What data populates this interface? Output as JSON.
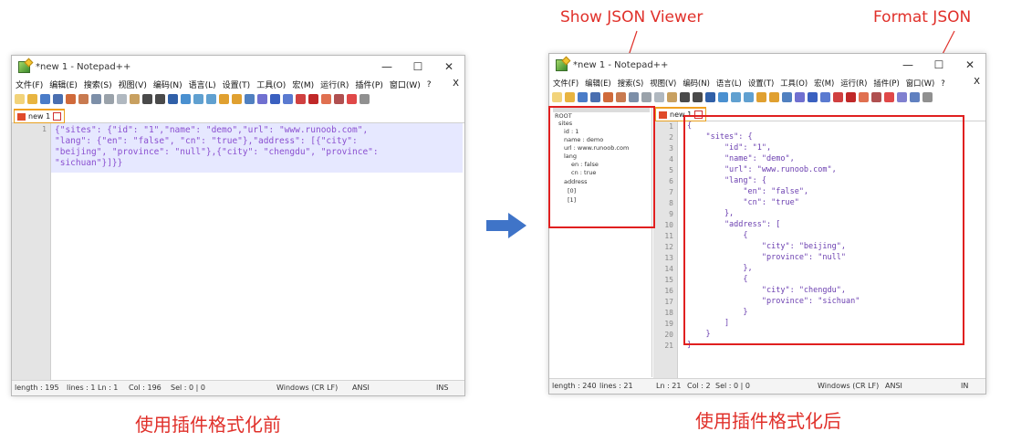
{
  "annotations": {
    "show_json_viewer": "Show JSON Viewer",
    "format_json": "Format JSON"
  },
  "captions": {
    "before": "使用插件格式化前",
    "after": "使用插件格式化后"
  },
  "editor": {
    "title": "*new 1 - Notepad++",
    "window_controls": [
      "—",
      "☐",
      "✕"
    ],
    "menu": [
      "文件(F)",
      "编辑(E)",
      "搜索(S)",
      "视图(V)",
      "编码(N)",
      "语言(L)",
      "设置(T)",
      "工具(O)",
      "宏(M)",
      "运行(R)",
      "插件(P)",
      "窗口(W)",
      "?"
    ],
    "menu_close": "X",
    "tab_label": "new 1"
  },
  "left_window": {
    "line_numbers": [
      "1"
    ],
    "code_lines": [
      "{\"sites\": {\"id\": \"1\",\"name\": \"demo\",\"url\": \"www.runoob.com\",",
      "\"lang\": {\"en\": \"false\", \"cn\": \"true\"},\"address\": [{\"city\":",
      "\"beijing\", \"province\": \"null\"},{\"city\": \"chengdu\", \"province\":",
      "\"sichuan\"}]}}"
    ],
    "status": {
      "length": "length : 195",
      "lines": "lines : 1",
      "ln": "Ln : 1",
      "col": "Col : 196",
      "sel": "Sel : 0 | 0",
      "eol": "Windows (CR LF)",
      "encoding": "ANSI",
      "mode": "INS"
    }
  },
  "right_window": {
    "tree": [
      {
        "label": "ROOT",
        "depth": 0
      },
      {
        "label": "sites",
        "depth": 1
      },
      {
        "label": "id : 1",
        "depth": 2
      },
      {
        "label": "name : demo",
        "depth": 2
      },
      {
        "label": "url : www.runoob.com",
        "depth": 2
      },
      {
        "label": "lang",
        "depth": 2
      },
      {
        "label": "en : false",
        "depth": 3
      },
      {
        "label": "cn : true",
        "depth": 3
      },
      {
        "label": "address",
        "depth": 2
      },
      {
        "label": "[0]",
        "depth": 3
      },
      {
        "label": "[1]",
        "depth": 3
      }
    ],
    "line_numbers": [
      "1",
      "2",
      "3",
      "4",
      "5",
      "6",
      "7",
      "8",
      "9",
      "10",
      "11",
      "12",
      "13",
      "14",
      "15",
      "16",
      "17",
      "18",
      "19",
      "20",
      "21"
    ],
    "code_lines": [
      "{",
      "    \"sites\": {",
      "        \"id\": \"1\",",
      "        \"name\": \"demo\",",
      "        \"url\": \"www.runoob.com\",",
      "        \"lang\": {",
      "            \"en\": \"false\",",
      "            \"cn\": \"true\"",
      "        },",
      "        \"address\": [",
      "            {",
      "                \"city\": \"beijing\",",
      "                \"province\": \"null\"",
      "            },",
      "            {",
      "                \"city\": \"chengdu\",",
      "                \"province\": \"sichuan\"",
      "            }",
      "        ]",
      "    }",
      "}"
    ],
    "status": {
      "length": "length : 240",
      "lines": "lines : 21",
      "ln": "Ln : 21",
      "col": "Col : 2",
      "sel": "Sel : 0 | 0",
      "eol": "Windows (CR LF)",
      "encoding": "ANSI",
      "mode": "IN"
    }
  },
  "colors": {
    "annotation_red": "#e0302a",
    "arrow_blue": "#3f74c8",
    "json_text_purple": "#8a4fd0",
    "selection_bg": "#e6e8ff"
  }
}
